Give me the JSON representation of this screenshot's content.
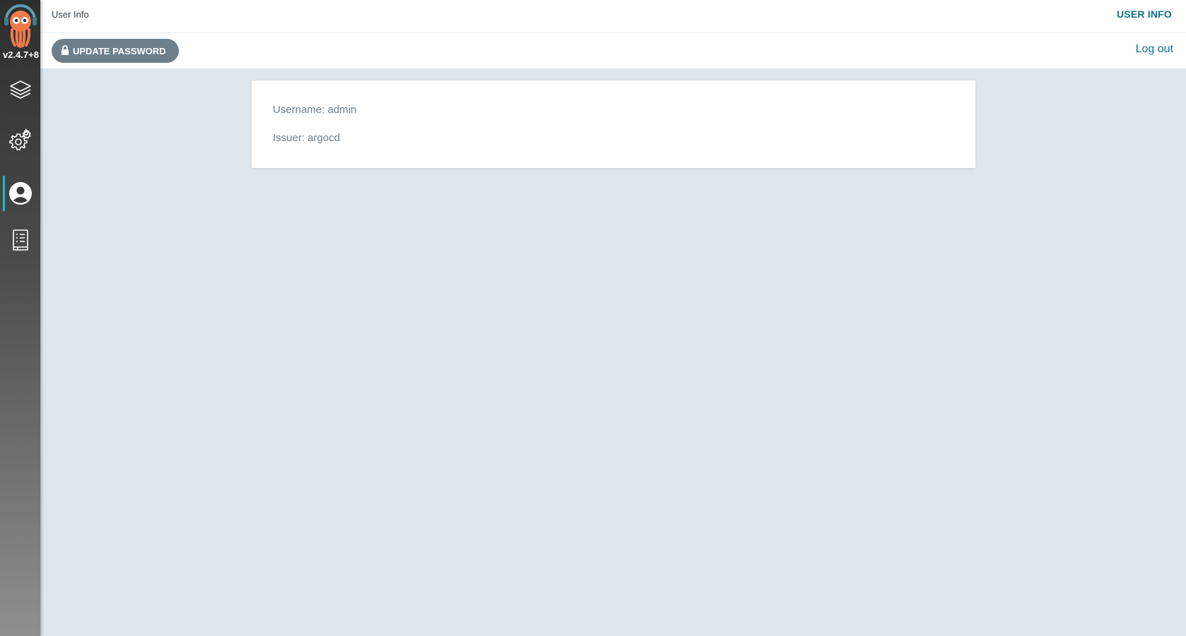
{
  "sidebar": {
    "version": "v2.4.7+8",
    "items": [
      {
        "name": "applications",
        "icon": "layers-icon"
      },
      {
        "name": "settings",
        "icon": "gears-icon"
      },
      {
        "name": "user-info",
        "icon": "user-circle-icon",
        "active": true
      },
      {
        "name": "documentation",
        "icon": "book-icon"
      }
    ]
  },
  "header": {
    "title": "User Info",
    "right_link": "USER INFO"
  },
  "toolbar": {
    "update_password_label": "UPDATE PASSWORD",
    "logout_label": "Log out"
  },
  "user": {
    "username_line": "Username: admin",
    "issuer_line": "Issuer: argocd"
  },
  "colors": {
    "accent": "#0e6f8c",
    "active_indicator": "#18bdd0",
    "button_bg": "#6d7f8b",
    "page_bg": "#dee6eb"
  }
}
